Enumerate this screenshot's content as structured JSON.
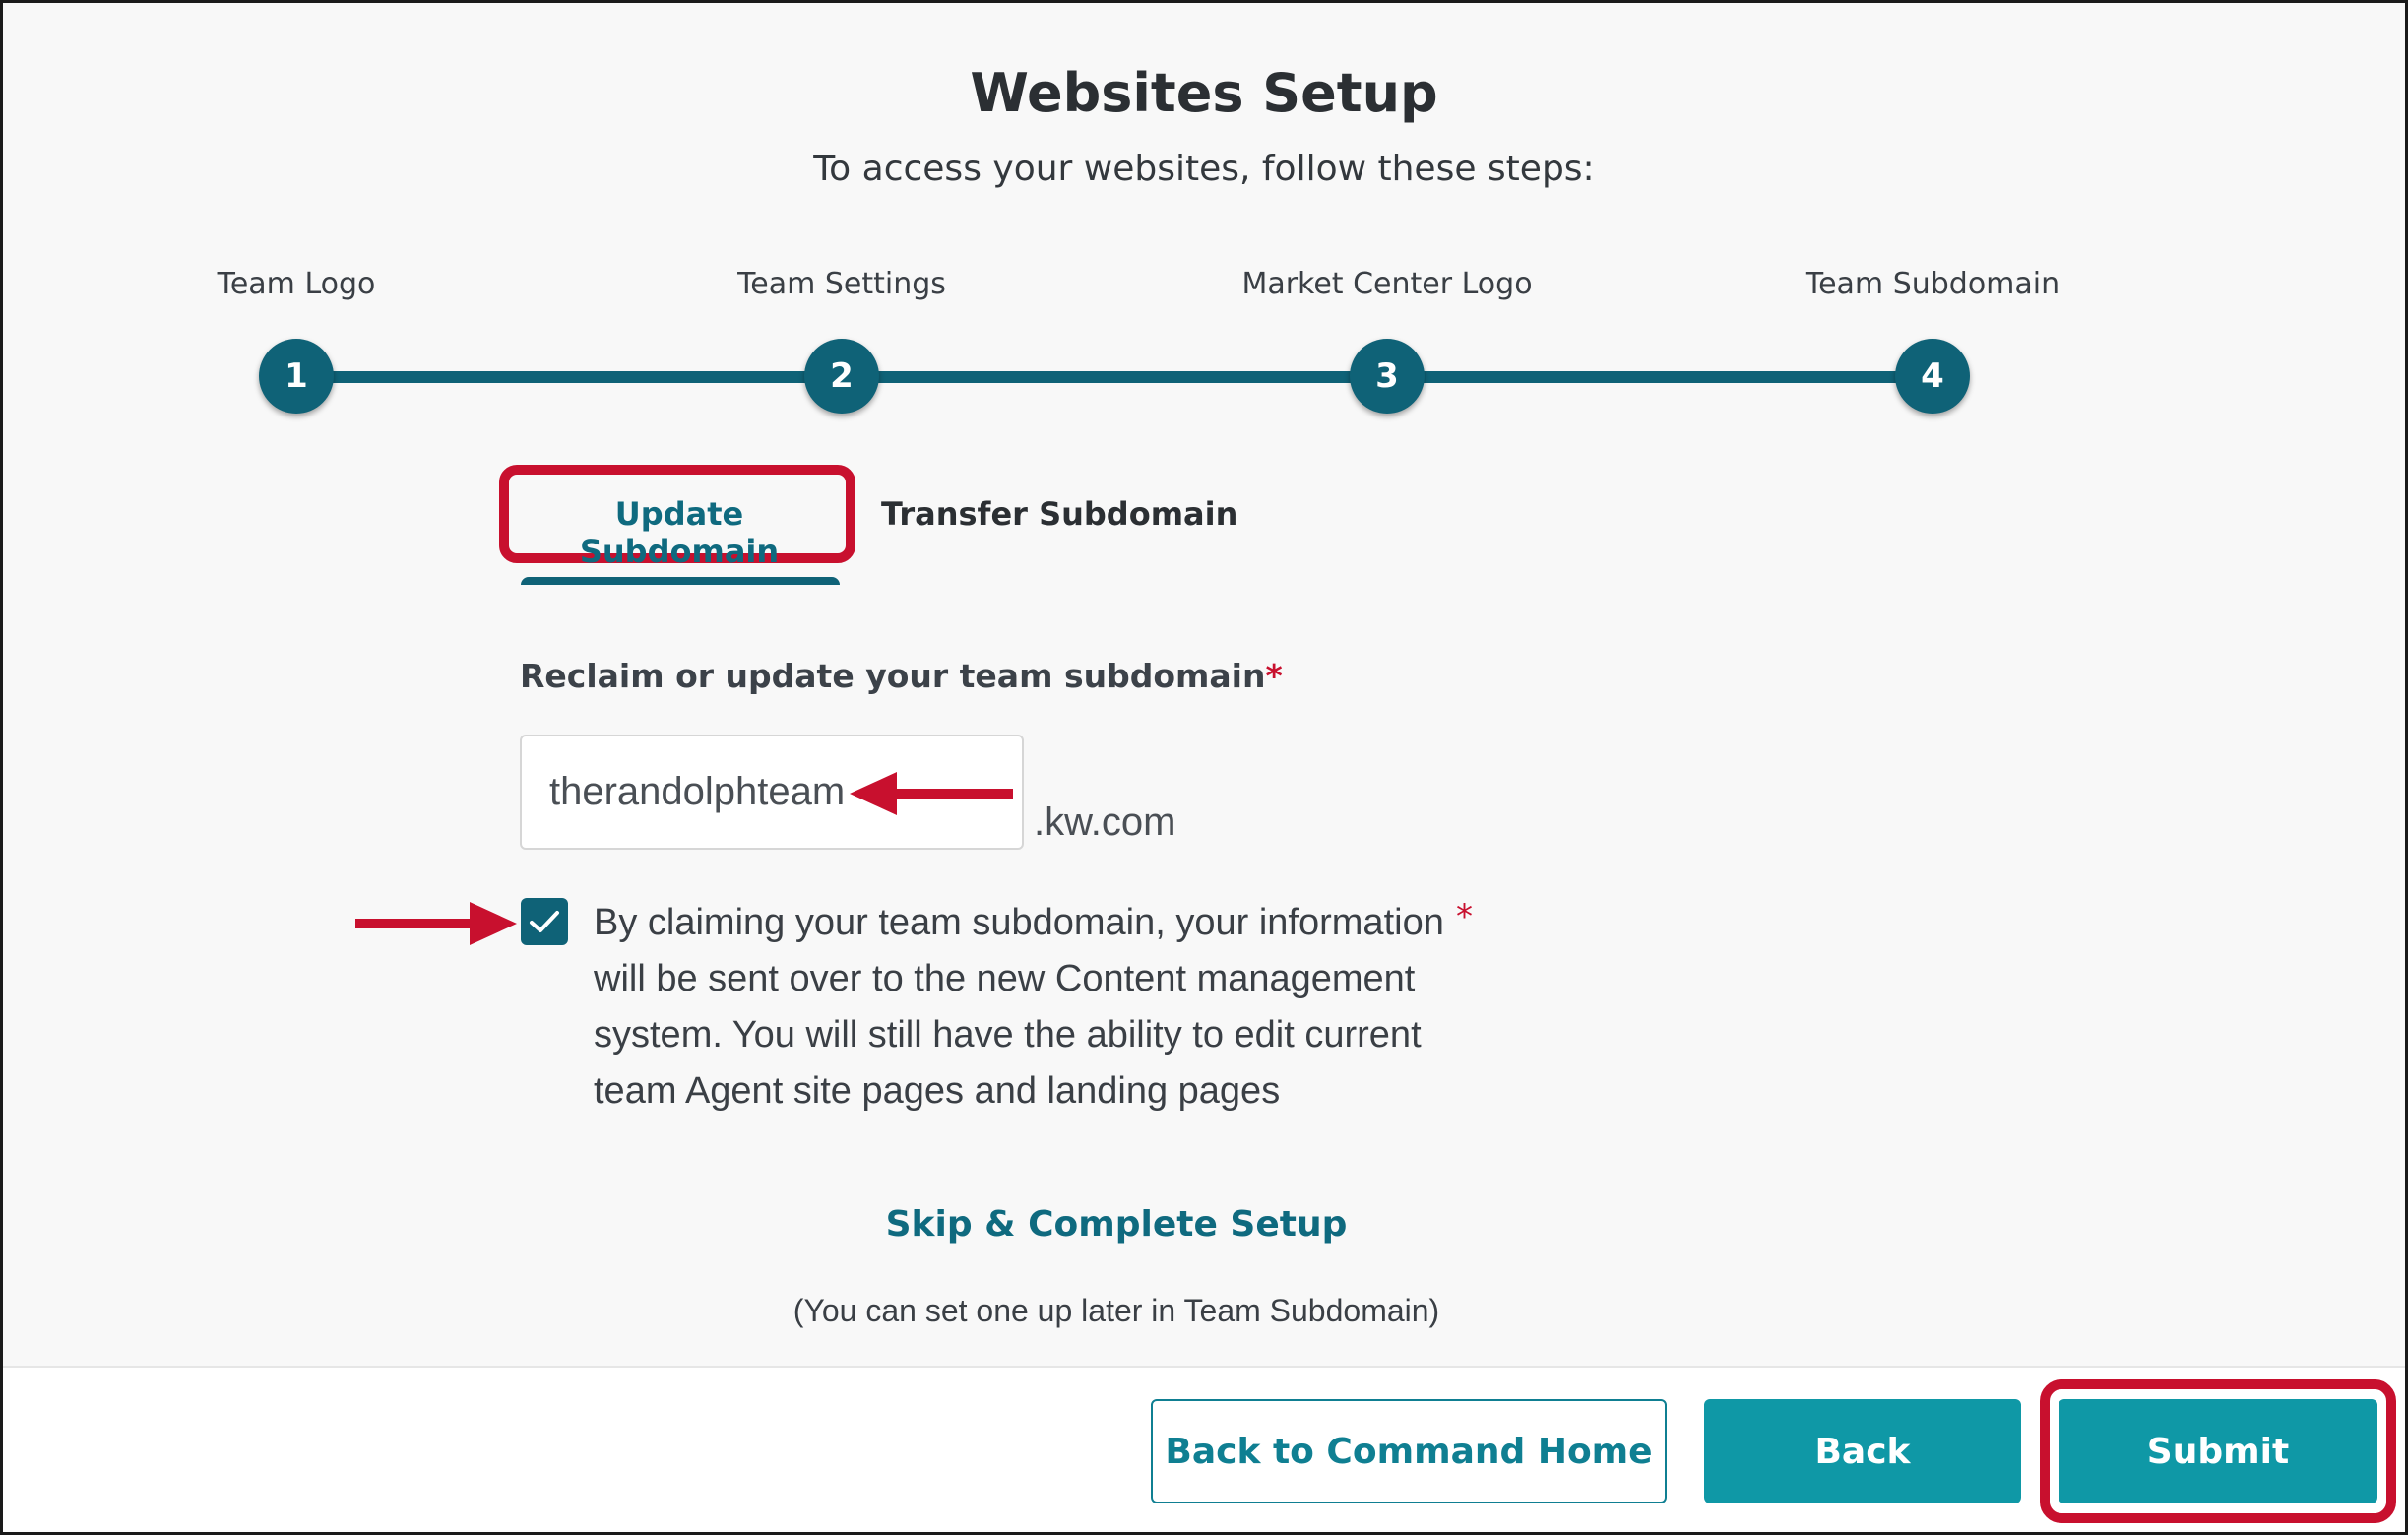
{
  "page": {
    "title": "Websites Setup",
    "subtitle": "To access your websites, follow these steps:"
  },
  "stepper": {
    "steps": [
      {
        "number": "1",
        "label": "Team Logo"
      },
      {
        "number": "2",
        "label": "Team Settings"
      },
      {
        "number": "3",
        "label": "Market Center Logo"
      },
      {
        "number": "4",
        "label": "Team Subdomain"
      }
    ]
  },
  "tabs": {
    "update": "Update Subdomain",
    "transfer": "Transfer Subdomain"
  },
  "form": {
    "label": "Reclaim or update your team subdomain",
    "required_mark": "*",
    "subdomain_value": "therandolphteam",
    "suffix": ".kw.com",
    "consent_text": "By claiming your team subdomain, your information will be sent over to the new Content management system. You will still have the ability to edit current team Agent site pages and landing pages",
    "consent_checked": true
  },
  "skip": {
    "link": "Skip & Complete Setup",
    "note": "(You can set one up later in Team Subdomain)"
  },
  "footer": {
    "back_home": "Back to Command Home",
    "back": "Back",
    "submit": "Submit"
  },
  "colors": {
    "primary": "#0f6277",
    "button": "#0f98a6",
    "annotation": "#c8102e"
  }
}
